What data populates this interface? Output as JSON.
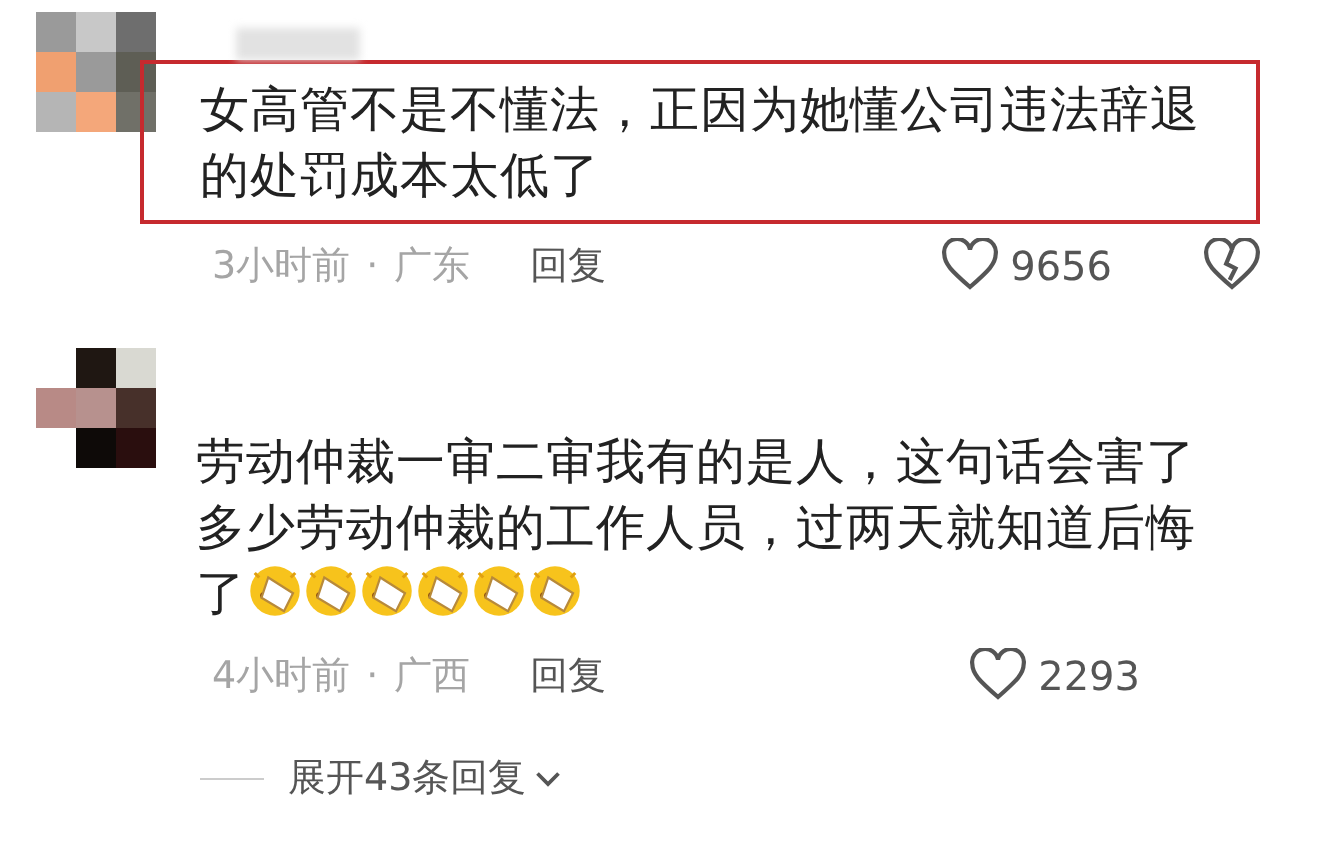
{
  "comments": [
    {
      "avatar": {
        "kind": "picture"
      },
      "lines": [
        "女高管不是不懂法，正因为她懂公司违法辞退",
        "的处罚成本太低了"
      ],
      "highlighted": true,
      "time": "3小时前",
      "separator": "·",
      "location": "广东",
      "reply": "回复",
      "likes": "9656",
      "dislike_button": true
    },
    {
      "avatar": {
        "kind": "picture"
      },
      "lines": [
        "劳动仲裁一审二审我有的是人，这句话会害了",
        "多少劳动仲裁的工作人员，过两天就知道后悔",
        "了"
      ],
      "highlighted": false,
      "emojis": [
        {
          "kind": "facepalm"
        },
        {
          "kind": "facepalm"
        },
        {
          "kind": "facepalm"
        },
        {
          "kind": "facepalm"
        },
        {
          "kind": "facepalm"
        },
        {
          "kind": "facepalm"
        }
      ],
      "time": "4小时前",
      "separator": "·",
      "location": "广西",
      "reply": "回复",
      "likes": "2293",
      "dislike_button": false
    }
  ],
  "expand_replies": "展开43条回复"
}
